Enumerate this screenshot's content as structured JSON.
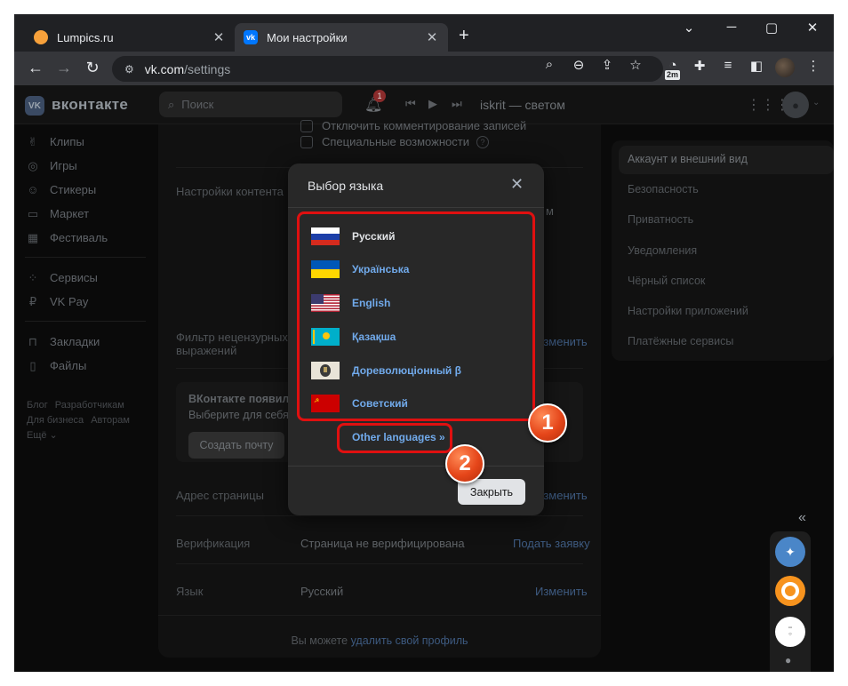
{
  "browser": {
    "tabs": [
      {
        "title": "Lumpics.ru",
        "favicon": "lumpics-favicon",
        "active": false
      },
      {
        "title": "Мои настройки",
        "favicon": "vk-favicon",
        "active": true
      }
    ],
    "url_host": "vk.com",
    "url_path": "/settings",
    "extension_badge": "2m"
  },
  "vk": {
    "brand": "вконтакте",
    "search_placeholder": "Поиск",
    "notifications_count": "1",
    "now_playing": "iskrit — светом",
    "left_nav": [
      {
        "label": "Клипы",
        "icon": "clips-icon"
      },
      {
        "label": "Игры",
        "icon": "gamepad-icon"
      },
      {
        "label": "Стикеры",
        "icon": "sticker-icon"
      },
      {
        "label": "Маркет",
        "icon": "market-bag-icon"
      },
      {
        "label": "Фестиваль",
        "icon": "festival-icon"
      },
      {
        "label": "Сервисы",
        "icon": "services-icon"
      },
      {
        "label": "VK Pay",
        "icon": "vkpay-icon"
      },
      {
        "label": "Закладки",
        "icon": "bookmark-icon"
      },
      {
        "label": "Файлы",
        "icon": "file-icon"
      }
    ],
    "footer_links": [
      "Блог",
      "Разработчикам",
      "Для бизнеса",
      "Авторам",
      "Ещё ⌄"
    ]
  },
  "settings": {
    "checkbox_comments": "Отключить комментирование записей",
    "checkbox_accessibility": "Специальные возможности",
    "content_settings_label": "Настройки контента",
    "content_settings_trailing": "м",
    "filter_label_line1": "Фильтр нецензурных",
    "filter_label_line2": "выражений",
    "filter_change": "Изменить",
    "mail_promo_title": "ВКонтакте появилась",
    "mail_promo_sub": "Выберите для себя п",
    "mail_button": "Создать почту",
    "address_label": "Адрес страницы",
    "address_change": "Изменить",
    "verification_label": "Верификация",
    "verification_value": "Страница не верифицирована",
    "verification_action": "Подать заявку",
    "language_label": "Язык",
    "language_value": "Русский",
    "language_change": "Изменить",
    "delete_prefix": "Вы можете ",
    "delete_link": "удалить свой профиль"
  },
  "right_menu": [
    {
      "label": "Аккаунт и внешний вид",
      "active": true
    },
    {
      "label": "Безопасность",
      "active": false
    },
    {
      "label": "Приватность",
      "active": false
    },
    {
      "label": "Уведомления",
      "active": false
    },
    {
      "label": "Чёрный список",
      "active": false
    },
    {
      "label": "Настройки приложений",
      "active": false
    },
    {
      "label": "Платёжные сервисы",
      "active": false
    }
  ],
  "modal": {
    "title": "Выбор языка",
    "languages": [
      {
        "label": "Русский",
        "flag": "russia-flag",
        "current": true
      },
      {
        "label": "Українська",
        "flag": "ukraine-flag",
        "current": false
      },
      {
        "label": "English",
        "flag": "usa-flag",
        "current": false
      },
      {
        "label": "Қазақша",
        "flag": "kazakhstan-flag",
        "current": false
      },
      {
        "label": "Дореволюціонный β",
        "flag": "imperial-coat-flag",
        "current": false
      },
      {
        "label": "Советский",
        "flag": "ussr-flag",
        "current": false
      }
    ],
    "other_languages": "Other languages »",
    "close_button": "Закрыть"
  },
  "annotations": {
    "marker_1": "1",
    "marker_2": "2",
    "highlight_color": "#e01010"
  },
  "colors": {
    "link_blue": "#71aaeb",
    "modal_bg": "#282828",
    "marker_orange": "#e5461a"
  }
}
